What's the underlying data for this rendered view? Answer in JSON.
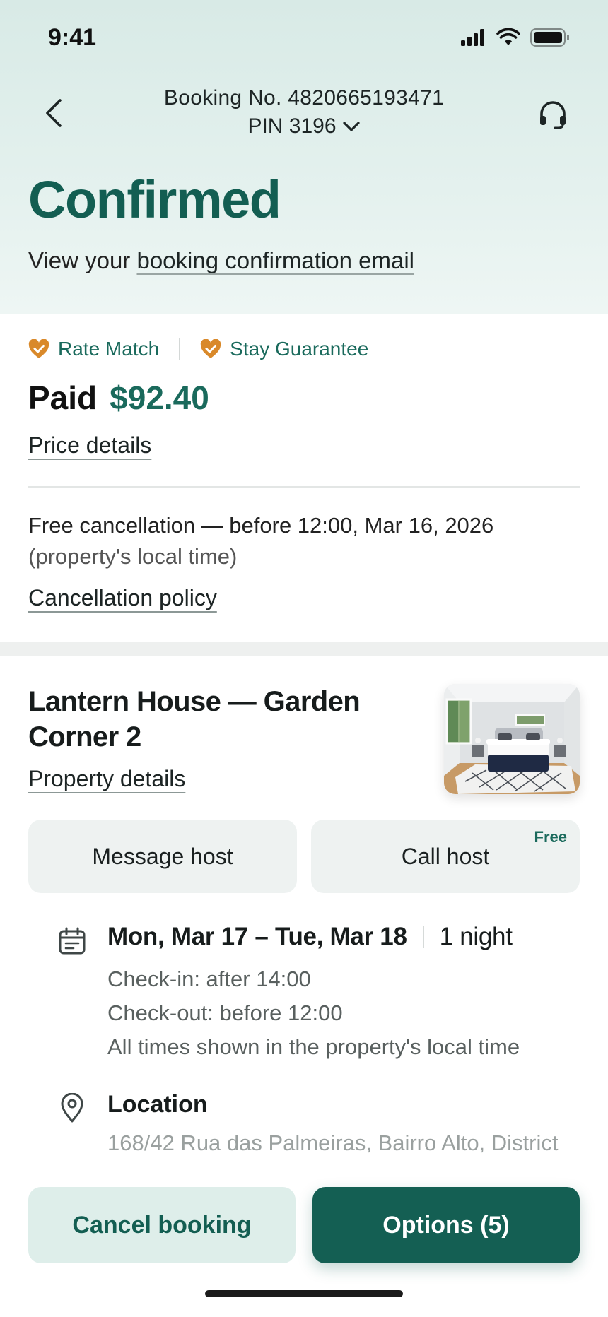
{
  "status_bar": {
    "time": "9:41"
  },
  "nav": {
    "booking_label": "Booking No. 4820665193471",
    "pin_label": "PIN 3196"
  },
  "hero": {
    "status": "Confirmed",
    "email_prefix": "View your ",
    "email_link": "booking confirmation email"
  },
  "guarantees": [
    {
      "label": "Rate Match",
      "icon": "heart-check-icon"
    },
    {
      "label": "Stay Guarantee",
      "icon": "heart-check-icon"
    }
  ],
  "payment": {
    "label": "Paid",
    "amount": "$92.40",
    "details_link": "Price details"
  },
  "cancellation": {
    "text": "Free cancellation — before 12:00, Mar 16, 2026",
    "note": "(property's local time)",
    "policy_link": "Cancellation policy"
  },
  "property": {
    "name": "Lantern House — Garden Corner 2",
    "details_link": "Property details",
    "photo": "bedroom-photo"
  },
  "host_actions": {
    "message_label": "Message host",
    "call_label": "Call host",
    "call_tag": "Free"
  },
  "stay": {
    "dates": "Mon, Mar 17 – Tue, Mar 18",
    "nights": "1 night",
    "check_in": "Check-in: after 14:00",
    "check_out": "Check-out: before 12:00",
    "times_note": "All times shown in the property's local time"
  },
  "location": {
    "title": "Location",
    "address": "168/42 Rua das Palmeiras, Bairro Alto, District"
  },
  "actions": {
    "cancel_label": "Cancel booking",
    "options_label": "Options (5)"
  },
  "colors": {
    "brand": "#135e52",
    "brand_light": "#deeeea",
    "accent_orange": "#d9892a",
    "hero_bg": "#d8eae6"
  }
}
